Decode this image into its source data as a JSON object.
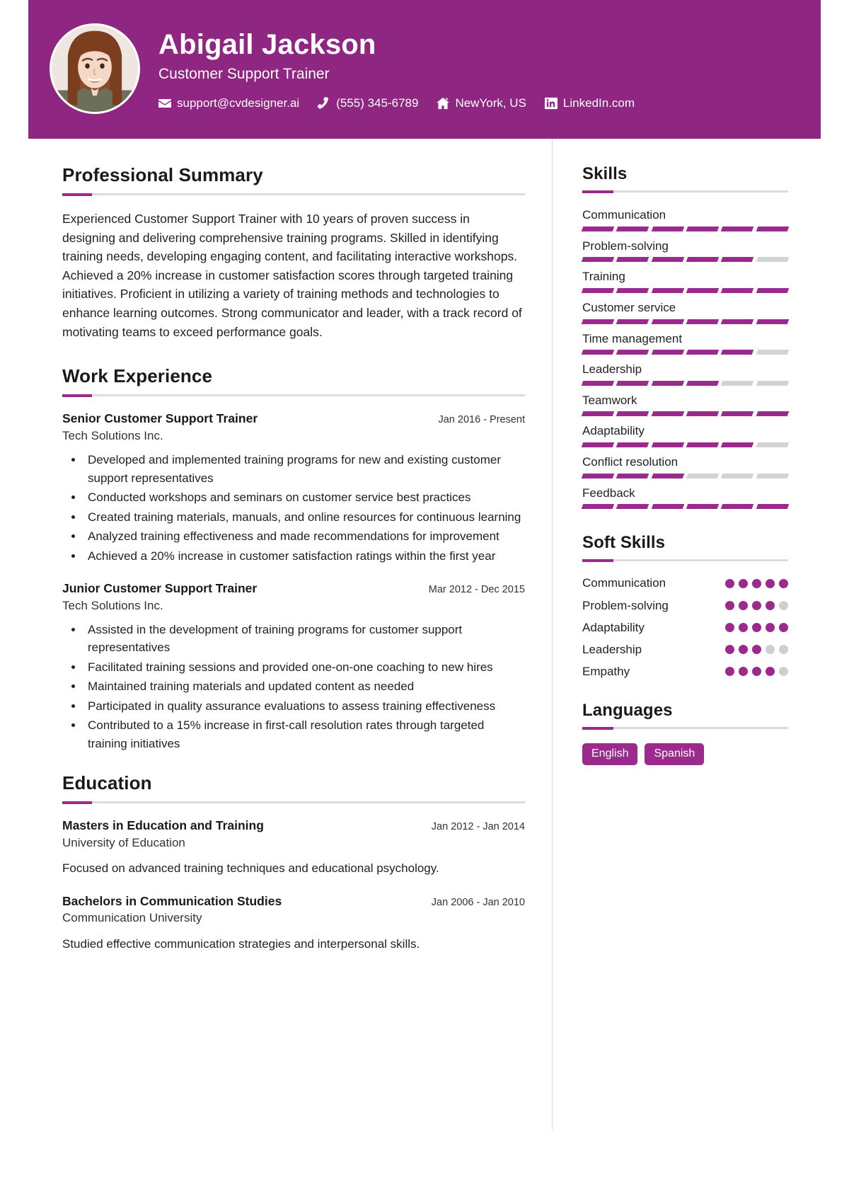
{
  "theme": {
    "accent": "#9b2a8d",
    "header_bg": "#8e2682",
    "track": "#d3d3d3",
    "text": "#1a1a1a"
  },
  "header": {
    "name": "Abigail Jackson",
    "job_title": "Customer Support Trainer",
    "avatar_alt": "profile-photo",
    "contacts": [
      {
        "icon": "envelope-icon",
        "text": "support@cvdesigner.ai"
      },
      {
        "icon": "phone-icon",
        "text": "(555) 345-6789"
      },
      {
        "icon": "home-icon",
        "text": "NewYork, US"
      },
      {
        "icon": "linkedin-icon",
        "text": "LinkedIn.com"
      }
    ]
  },
  "main": {
    "summary": {
      "title": "Professional Summary",
      "text": "Experienced Customer Support Trainer with 10 years of proven success in designing and delivering comprehensive training programs. Skilled in identifying training needs, developing engaging content, and facilitating interactive workshops. Achieved a 20% increase in customer satisfaction scores through targeted training initiatives. Proficient in utilizing a variety of training methods and technologies to enhance learning outcomes. Strong communicator and leader, with a track record of motivating teams to exceed performance goals."
    },
    "experience": {
      "title": "Work Experience",
      "entries": [
        {
          "role": "Senior Customer Support Trainer",
          "date": "Jan 2016 - Present",
          "organization": "Tech Solutions Inc.",
          "bullets": [
            "Developed and implemented training programs for new and existing customer support representatives",
            "Conducted workshops and seminars on customer service best practices",
            "Created training materials, manuals, and online resources for continuous learning",
            "Analyzed training effectiveness and made recommendations for improvement",
            "Achieved a 20% increase in customer satisfaction ratings within the first year"
          ]
        },
        {
          "role": "Junior Customer Support Trainer",
          "date": "Mar 2012 - Dec 2015",
          "organization": "Tech Solutions Inc.",
          "bullets": [
            "Assisted in the development of training programs for customer support representatives",
            "Facilitated training sessions and provided one-on-one coaching to new hires",
            "Maintained training materials and updated content as needed",
            "Participated in quality assurance evaluations to assess training effectiveness",
            "Contributed to a 15% increase in first-call resolution rates through targeted training initiatives"
          ]
        }
      ]
    },
    "education": {
      "title": "Education",
      "entries": [
        {
          "degree": "Masters in Education and Training",
          "date": "Jan 2012 - Jan 2014",
          "institution": "University of Education",
          "description": "Focused on advanced training techniques and educational psychology."
        },
        {
          "degree": "Bachelors in Communication Studies",
          "date": "Jan 2006 - Jan 2010",
          "institution": "Communication University",
          "description": "Studied effective communication strategies and interpersonal skills."
        }
      ]
    }
  },
  "sidebar": {
    "skills": {
      "title": "Skills",
      "max_segments": 6,
      "items": [
        {
          "name": "Communication",
          "level": 6
        },
        {
          "name": "Problem-solving",
          "level": 5
        },
        {
          "name": "Training",
          "level": 6
        },
        {
          "name": "Customer service",
          "level": 6
        },
        {
          "name": "Time management",
          "level": 5
        },
        {
          "name": "Leadership",
          "level": 4
        },
        {
          "name": "Teamwork",
          "level": 6
        },
        {
          "name": "Adaptability",
          "level": 5
        },
        {
          "name": "Conflict resolution",
          "level": 3
        },
        {
          "name": "Feedback",
          "level": 6
        }
      ]
    },
    "soft_skills": {
      "title": "Soft Skills",
      "max_dots": 5,
      "items": [
        {
          "name": "Communication",
          "level": 5
        },
        {
          "name": "Problem-solving",
          "level": 4
        },
        {
          "name": "Adaptability",
          "level": 5
        },
        {
          "name": "Leadership",
          "level": 3
        },
        {
          "name": "Empathy",
          "level": 4
        }
      ]
    },
    "languages": {
      "title": "Languages",
      "items": [
        "English",
        "Spanish"
      ]
    }
  }
}
